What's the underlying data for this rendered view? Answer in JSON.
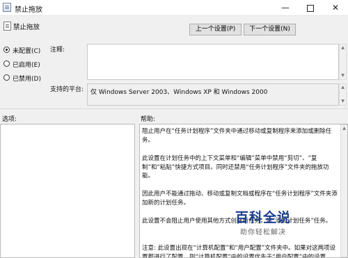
{
  "window": {
    "title": "禁止拖放",
    "min_glyph": "—",
    "close_glyph": "✕"
  },
  "setting": {
    "name": "禁止拖放"
  },
  "nav": {
    "prev_label": "上一个设置(P)",
    "next_label": "下一个设置(N)"
  },
  "radios": [
    {
      "label": "未配置(C)",
      "selected": true
    },
    {
      "label": "已启用(E)",
      "selected": false
    },
    {
      "label": "已禁用(D)",
      "selected": false
    }
  ],
  "labels": {
    "comment": "注释:",
    "platform": "支持的平台:",
    "options": "选项:",
    "help": "帮助:"
  },
  "comment": {
    "value": ""
  },
  "platform": {
    "value": "仅 Windows Server 2003、Windows XP 和 Windows 2000"
  },
  "help": {
    "paragraphs": [
      "阻止用户在“任务计划程序”文件夹中通过移动或复制程序来添加或删除任务。",
      "此设置在计划任务中的上下文菜单和“编辑”菜单中禁用“剪切”、“复制”和“粘贴”快捷方式项目。同时还禁用“任务计划程序”文件夹的拖放功能。",
      "因此用户不能通过拖动、移动或复制文档或程序在“任务计划程序”文件夹添加新的计划任务。",
      "此设置不会阻止用户使用其他方式创建新任务，如“添加计划任务”任务。",
      "注意: 此设置出现在“计算机配置”和“用户配置”文件夹中。如果对这两项设置都进行了配置，则“计算机配置”中的设置优先于“用户配置”中的设置。"
    ]
  },
  "watermark": {
    "main": "百科全说",
    "sub": "助你轻松解决"
  }
}
